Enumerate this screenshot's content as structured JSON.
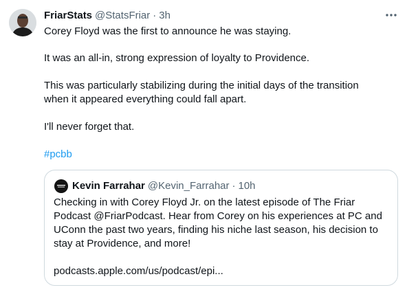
{
  "tweet": {
    "author": {
      "display_name": "FriarStats",
      "handle": "@StatsFriar",
      "separator": "·",
      "time": "3h",
      "avatar_icon": "user-avatar"
    },
    "more_icon": "more-horizontal-icon",
    "body_lines": [
      "Corey Floyd was the first to announce he was staying.",
      "It was an all-in, strong expression of loyalty to Providence.",
      "This was particularly stabilizing during the initial days of the transition",
      "when it appeared everything could fall apart.",
      "I'll never forget that."
    ],
    "hashtag": "#pcbb",
    "link_color": "#1d9bf0",
    "quoted": {
      "display_name": "Kevin Farrahar",
      "handle": "@Kevin_Farrahar",
      "separator": "·",
      "time": "10h",
      "avatar_icon": "podcast-logo-avatar",
      "body_lines": [
        "Checking in with Corey Floyd Jr. on the latest episode of The Friar",
        "Podcast @FriarPodcast. Hear from Corey on his experiences at PC and",
        "UConn the past two years, finding his niche last season, his decision to",
        "stay at Providence, and more!",
        "podcasts.apple.com/us/podcast/epi..."
      ]
    }
  }
}
